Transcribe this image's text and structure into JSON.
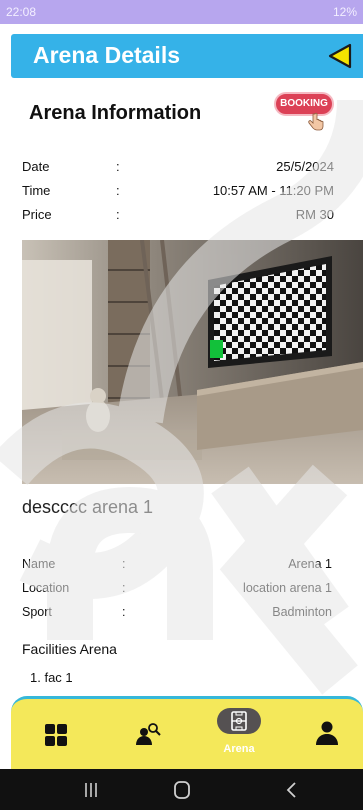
{
  "status_bar": {
    "time": "22:08",
    "right_text": "12%"
  },
  "header": {
    "title": "Arena Details",
    "back_icon": "back-triangle-icon"
  },
  "section": {
    "title": "Arena Information",
    "booking_label": "BOOKING"
  },
  "info": [
    {
      "label": "Date",
      "sep": ":",
      "value": "25/5/2024"
    },
    {
      "label": "Time",
      "sep": ":",
      "value": "10:57 AM - 11:20 PM"
    },
    {
      "label": "Price",
      "sep": ":",
      "value": "RM 30"
    }
  ],
  "description": "descccc arena 1",
  "details": [
    {
      "label": "Name",
      "sep": ":",
      "value": "Arena 1"
    },
    {
      "label": "Location",
      "sep": ":",
      "value": "location arena 1"
    },
    {
      "label": "Sport",
      "sep": ":",
      "value": "Badminton"
    }
  ],
  "facilities": {
    "title": "Facilities Arena",
    "items": [
      "1. fac 1"
    ]
  },
  "bottom_nav": {
    "items": [
      {
        "icon": "grid-icon",
        "label": ""
      },
      {
        "icon": "user-search-icon",
        "label": ""
      },
      {
        "icon": "arena-icon",
        "label": "Arena",
        "active": true
      },
      {
        "icon": "person-icon",
        "label": ""
      }
    ]
  },
  "colors": {
    "header": "#35b2e8",
    "nav_background": "#f4e85a",
    "back_button": "#f5e400",
    "booking": "#dc4156"
  }
}
